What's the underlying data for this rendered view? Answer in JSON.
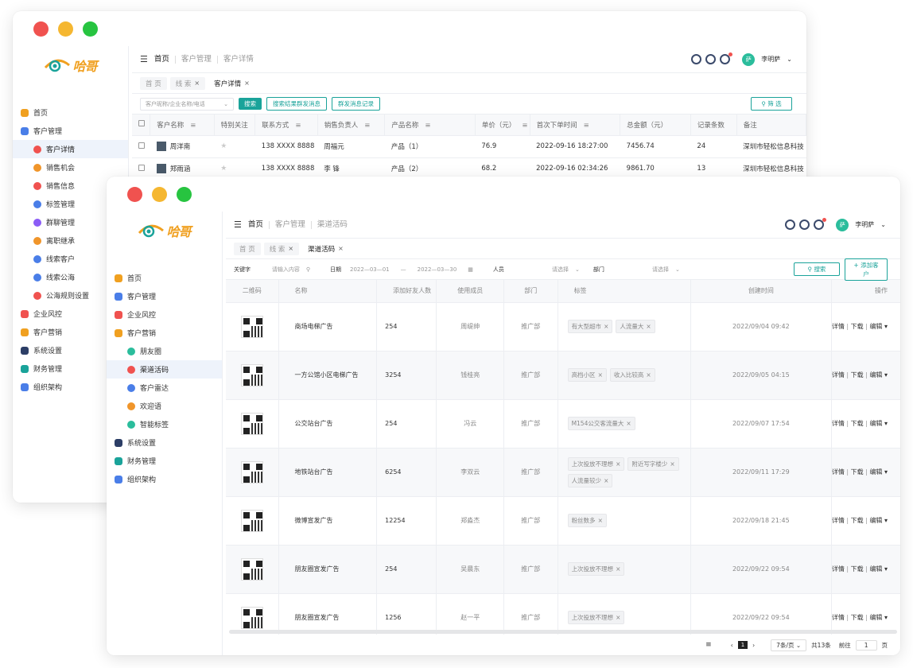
{
  "logo_text": "哈哥",
  "win1": {
    "sidebar": [
      {
        "label": "首页",
        "icon": "home-icon",
        "color": "#f0a020",
        "sub": false,
        "active": false
      },
      {
        "label": "客户管理",
        "icon": "customer-icon",
        "color": "#4a7ee8",
        "sub": false,
        "active": false
      },
      {
        "label": "客户详情",
        "icon": "detail-icon",
        "color": "#f0524f",
        "sub": true,
        "active": true
      },
      {
        "label": "销售机会",
        "icon": "chance-icon",
        "color": "#f0952a",
        "sub": true,
        "active": false
      },
      {
        "label": "销售信息",
        "icon": "info-icon",
        "color": "#f0524f",
        "sub": true,
        "active": false
      },
      {
        "label": "标签管理",
        "icon": "tag-icon",
        "color": "#4a7ee8",
        "sub": true,
        "active": false
      },
      {
        "label": "群聊管理",
        "icon": "chat-icon",
        "color": "#8b5cf6",
        "sub": true,
        "active": false
      },
      {
        "label": "离职继承",
        "icon": "inherit-icon",
        "color": "#f0952a",
        "sub": true,
        "active": false
      },
      {
        "label": "线索客户",
        "icon": "lead-icon",
        "color": "#4a7ee8",
        "sub": true,
        "active": false
      },
      {
        "label": "线索公海",
        "icon": "sea-icon",
        "color": "#4a7ee8",
        "sub": true,
        "active": false
      },
      {
        "label": "公海规则设置",
        "icon": "rule-icon",
        "color": "#f0524f",
        "sub": true,
        "active": false
      },
      {
        "label": "企业风控",
        "icon": "shield-icon",
        "color": "#f0524f",
        "sub": false,
        "active": false
      },
      {
        "label": "客户营销",
        "icon": "bell-icon",
        "color": "#f0a020",
        "sub": false,
        "active": false
      },
      {
        "label": "系统设置",
        "icon": "gear-icon",
        "color": "#2c3e66",
        "sub": false,
        "active": false
      },
      {
        "label": "财务管理",
        "icon": "finance-icon",
        "color": "#1aa39a",
        "sub": false,
        "active": false
      },
      {
        "label": "组织架构",
        "icon": "org-icon",
        "color": "#4a7ee8",
        "sub": false,
        "active": false
      }
    ],
    "crumbs": [
      "首页",
      "客户管理",
      "客户详情"
    ],
    "tabs": [
      {
        "label": "首 页",
        "active": false,
        "close": ""
      },
      {
        "label": "线 索",
        "active": false,
        "close": "×"
      },
      {
        "label": "客户详情",
        "active": true,
        "close": "×"
      }
    ],
    "filter": {
      "placeholder": "客户昵称/企业名称/电话",
      "search": "搜索",
      "mass_send": "搜索结果群发消息",
      "records": "群发消息记录",
      "screen": "筛 选"
    },
    "columns": [
      "客户名称",
      "特别关注",
      "联系方式",
      "销售负责人",
      "产品名称",
      "单价（元）",
      "首次下单时间",
      "总金额（元）",
      "记录条数",
      "备注"
    ],
    "rows": [
      {
        "name": "周洋南",
        "phone": "138 XXXX 8888",
        "owner": "周福元",
        "product": "产品（1）",
        "price": "76.9",
        "time": "2022-09-16 18:27:00",
        "total": "7456.74",
        "count": "24",
        "note": "深圳市轻松信息科技"
      },
      {
        "name": "郑雨涵",
        "phone": "138 XXXX 8888",
        "owner": "李 锋",
        "product": "产品（2）",
        "price": "68.2",
        "time": "2022-09-16 02:34:26",
        "total": "9861.70",
        "count": "13",
        "note": "深圳市轻松信息科技"
      }
    ]
  },
  "win2": {
    "sidebar": [
      {
        "label": "首页",
        "icon": "home-icon",
        "color": "#f0a020",
        "sub": false,
        "active": false
      },
      {
        "label": "客户管理",
        "icon": "customer-icon",
        "color": "#4a7ee8",
        "sub": false,
        "active": false
      },
      {
        "label": "企业风控",
        "icon": "shield-icon",
        "color": "#f0524f",
        "sub": false,
        "active": false
      },
      {
        "label": "客户营销",
        "icon": "bell-icon",
        "color": "#f0a020",
        "sub": false,
        "active": false
      },
      {
        "label": "朋友圈",
        "icon": "moments-icon",
        "color": "#2bbd9c",
        "sub": true,
        "active": false
      },
      {
        "label": "渠道活码",
        "icon": "qrcode-icon",
        "color": "#f0524f",
        "sub": true,
        "active": true
      },
      {
        "label": "客户雷达",
        "icon": "radar-icon",
        "color": "#4a7ee8",
        "sub": true,
        "active": false
      },
      {
        "label": "欢迎语",
        "icon": "welcome-icon",
        "color": "#f0952a",
        "sub": true,
        "active": false
      },
      {
        "label": "智能标签",
        "icon": "smart-tag-icon",
        "color": "#2bbd9c",
        "sub": true,
        "active": false
      },
      {
        "label": "系统设置",
        "icon": "gear-icon",
        "color": "#2c3e66",
        "sub": false,
        "active": false
      },
      {
        "label": "财务管理",
        "icon": "finance-icon",
        "color": "#1aa39a",
        "sub": false,
        "active": false
      },
      {
        "label": "组织架构",
        "icon": "org-icon",
        "color": "#4a7ee8",
        "sub": false,
        "active": false
      }
    ],
    "crumbs": [
      "首页",
      "客户管理",
      "渠道活码"
    ],
    "tabs": [
      {
        "label": "首 页",
        "active": false,
        "close": ""
      },
      {
        "label": "线 索",
        "active": false,
        "close": "×"
      },
      {
        "label": "渠道活码",
        "active": true,
        "close": "×"
      }
    ],
    "filter": {
      "keyword_label": "关键字",
      "keyword_placeholder": "请输入内容",
      "date_label": "日期",
      "date_start": "2022—03—01",
      "date_sep": "—",
      "date_end": "2022—03—30",
      "person_label": "人员",
      "person_placeholder": "请选择",
      "dept_label": "部门",
      "dept_placeholder": "请选择",
      "search": "搜索",
      "add": "添加客户"
    },
    "columns": [
      "二维码",
      "名称",
      "添加好友人数",
      "使用成员",
      "部门",
      "标签",
      "创建时间",
      "操作"
    ],
    "rows": [
      {
        "name": "商场电梯广告",
        "count": "254",
        "member": "周缇绅",
        "dept": "推广部",
        "tags": [
          "有大型超市",
          "人流量大"
        ],
        "time": "2022/09/04 09:42"
      },
      {
        "name": "一方公馆小区电梯广告",
        "count": "3254",
        "member": "钱桂亮",
        "dept": "推广部",
        "tags": [
          "高档小区",
          "收入比较高"
        ],
        "time": "2022/09/05 04:15"
      },
      {
        "name": "公交站台广告",
        "count": "254",
        "member": "冯云",
        "dept": "推广部",
        "tags": [
          "M154公交客流量大"
        ],
        "time": "2022/09/07 17:54"
      },
      {
        "name": "地铁站台广告",
        "count": "6254",
        "member": "李双云",
        "dept": "推广部",
        "tags": [
          "上次投放不理想",
          "附近写字楼少",
          "人流量较少"
        ],
        "time": "2022/09/11 17:29"
      },
      {
        "name": "微博宣发广告",
        "count": "12254",
        "member": "郑淼杰",
        "dept": "推广部",
        "tags": [
          "粉丝数多"
        ],
        "time": "2022/09/18 21:45"
      },
      {
        "name": "朋友圈宣发广告",
        "count": "254",
        "member": "吴晨东",
        "dept": "推广部",
        "tags": [
          "上次投放不理想"
        ],
        "time": "2022/09/22 09:54"
      },
      {
        "name": "朋友圈宣发广告",
        "count": "1256",
        "member": "赵一平",
        "dept": "推广部",
        "tags": [
          "上次投放不理想"
        ],
        "time": "2022/09/22 09:54"
      }
    ],
    "action_detail": "详情",
    "action_download": "下载",
    "action_edit": "编辑",
    "pager": {
      "page": "1",
      "size": "7条/页",
      "total": "共13条",
      "goto": "前往",
      "goto_page": "1",
      "unit": "页"
    }
  },
  "user": {
    "name": "李明萨",
    "avatar": "萨"
  }
}
